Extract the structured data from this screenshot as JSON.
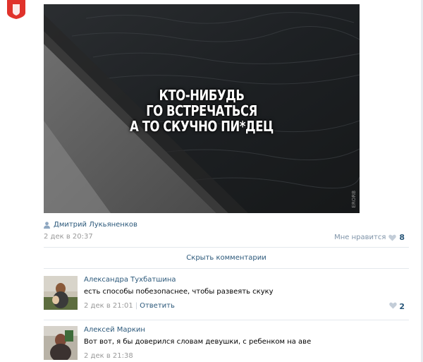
{
  "post": {
    "caption_lines": [
      "КТО-НИБУДЬ",
      "ГО ВСТРЕЧАТЬСЯ",
      "А ТО СКУЧНО ПИ*ДЕЦ"
    ],
    "watermark": "ERORB",
    "author": "Дмитрий Лукьяненков",
    "date": "2 дек в 20:37",
    "like_label": "Мне нравится",
    "like_count": "8"
  },
  "comments_toggle": "Скрыть комментарии",
  "comments": [
    {
      "name": "Александра Тухбатшина",
      "text": "есть способы побезопаснее, чтобы развеять скуку",
      "date": "2 дек в 21:01",
      "reply": "Ответить",
      "likes": "2"
    },
    {
      "name": "Алексей Маркин",
      "text": "Вот вот, я бы доверился словам девушки, с ребенком на аве",
      "date": "2 дек в 21:38"
    }
  ],
  "colors": {
    "link": "#2b587a",
    "muted": "#999999",
    "logo": "#e0322b",
    "heart": "#c3cdd8"
  },
  "icons": [
    "app-logo-icon",
    "person-icon",
    "heart-icon"
  ]
}
